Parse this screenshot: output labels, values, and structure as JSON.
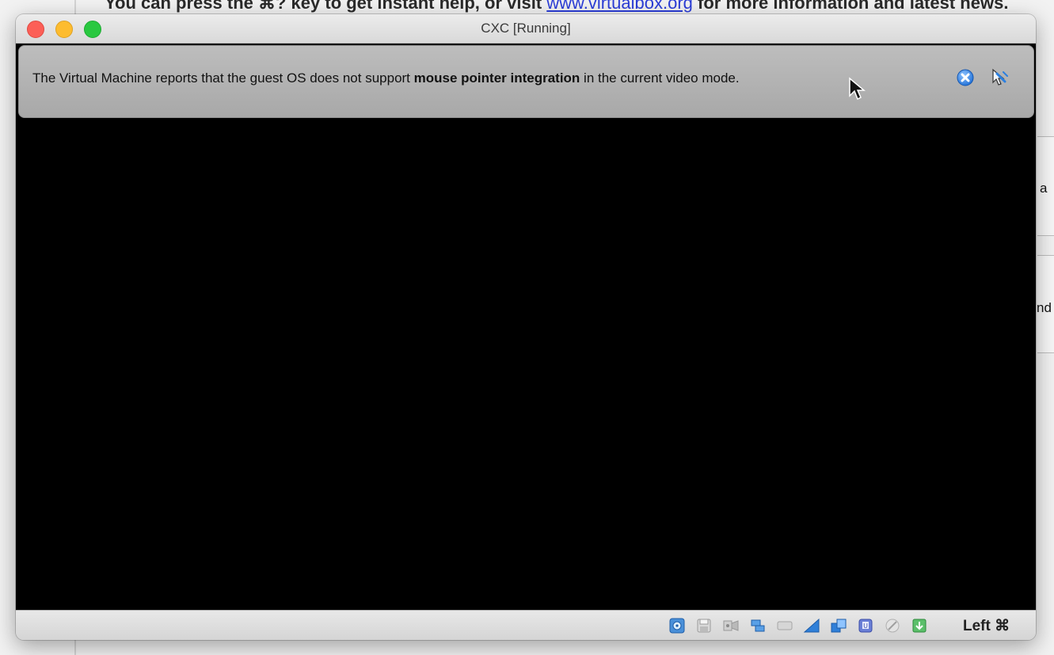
{
  "background": {
    "header_prefix": "You can press the ",
    "header_key": "⌘?",
    "header_middle": " key to get instant help, or visit ",
    "header_link": "www.virtualbox.org",
    "header_suffix": " for more information and latest news.",
    "partial_text_1": "a",
    "partial_text_2": "nd"
  },
  "window": {
    "title": "CXC [Running]"
  },
  "notice": {
    "text_before": "The Virtual Machine reports that the guest OS does not support ",
    "text_bold": "mouse pointer integration",
    "text_after": " in the current video mode.",
    "close_icon": "close-circle-icon",
    "mute_icon": "mouse-integration-off-icon"
  },
  "statusbar": {
    "icons": [
      "hard-disk-icon",
      "floppy-icon",
      "optical-drive-icon",
      "network-icon",
      "usb-icon",
      "shared-folders-icon",
      "display-icon",
      "video-capture-icon",
      "cpu-icon",
      "mouse-integration-icon",
      "keyboard-capture-icon"
    ],
    "host_key": "Left ⌘"
  },
  "colors": {
    "close": "#fc5f57",
    "minimize": "#fdbc2f",
    "zoom": "#29c840",
    "accent_blue": "#2a7fe0"
  }
}
